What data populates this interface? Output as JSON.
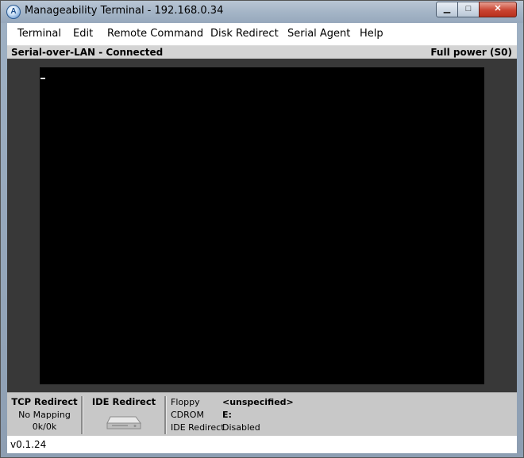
{
  "window": {
    "title": "Manageability Terminal - 192.168.0.34",
    "app_icon_glyph": "A",
    "controls": {
      "minimize": "▁",
      "maximize": "□",
      "close": "✕"
    }
  },
  "menu": {
    "items": [
      {
        "label": "Terminal"
      },
      {
        "label": "Edit"
      },
      {
        "label": "Remote Command"
      },
      {
        "label": "Disk Redirect"
      },
      {
        "label": "Serial Agent"
      },
      {
        "label": "Help"
      }
    ]
  },
  "status": {
    "connection": "Serial-over-LAN - Connected",
    "power": "Full power (S0)"
  },
  "bottom_panel": {
    "tcp_redirect": {
      "title": "TCP Redirect",
      "mapping": "No Mapping",
      "traffic": "0k/0k"
    },
    "ide_redirect": {
      "title": "IDE Redirect",
      "icon": "disk-drive-icon"
    },
    "disks": {
      "floppy_label": "Floppy",
      "floppy_value": "<unspecified>",
      "cdrom_label": "CDROM",
      "cdrom_value": "E:",
      "ide_label": "IDE Redirect",
      "ide_value": "Disabled"
    }
  },
  "footer": {
    "version": "v0.1.24"
  },
  "colors": {
    "terminal_bg": "#000000",
    "terminal_border": "#383838",
    "panel_bg": "#c8c8c8",
    "status_bg": "#d4d4d4"
  }
}
